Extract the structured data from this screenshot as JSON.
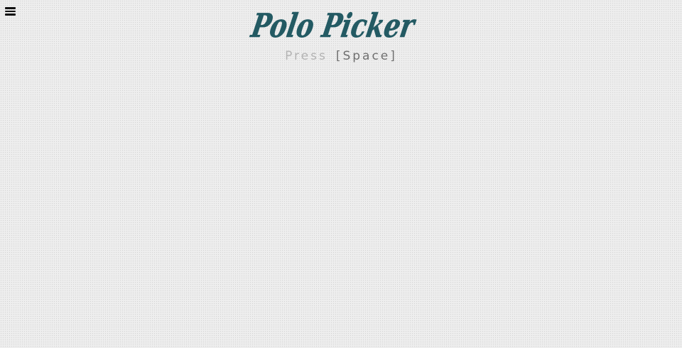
{
  "menu": {
    "icon": "hamburger-menu-icon"
  },
  "app": {
    "title": "Polo Picker",
    "accent_color": "#235a63"
  },
  "prompt": {
    "press_label": "Press",
    "key_label": "[Space]",
    "press_color": "#b3b3b3",
    "key_color": "#6f6f6f"
  },
  "page": {
    "background_color": "#ececec"
  }
}
